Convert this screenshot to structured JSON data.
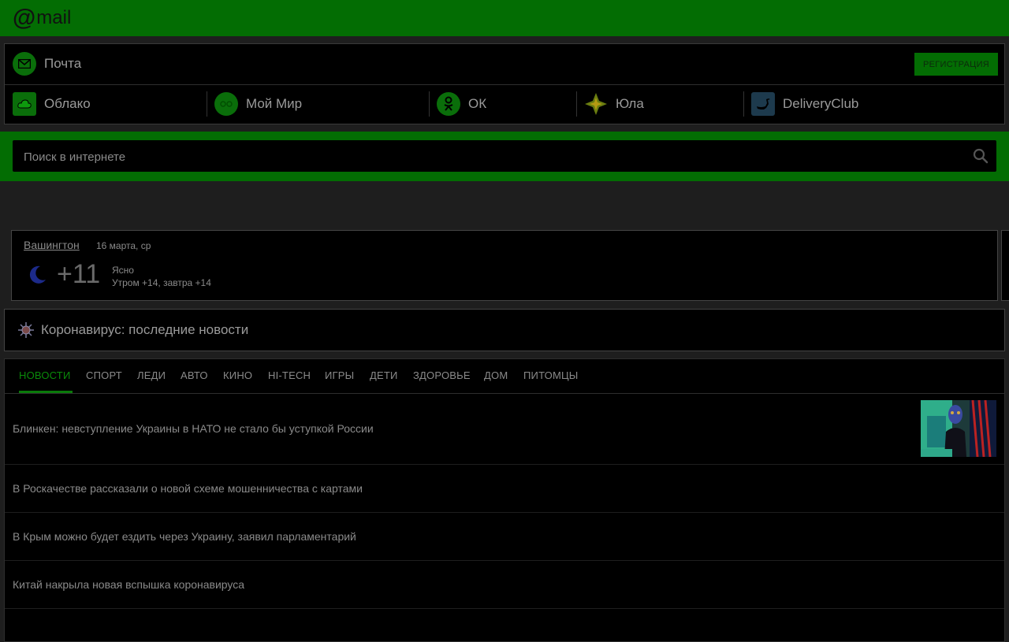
{
  "header": {
    "logo_at": "@",
    "logo_text": "mail"
  },
  "services": {
    "mail_label": "Почта",
    "register_label": "РЕГИСТРАЦИЯ",
    "items": [
      {
        "label": "Облако",
        "icon": "cloud-icon"
      },
      {
        "label": "Мой Мир",
        "icon": "my-world-icon"
      },
      {
        "label": "ОК",
        "icon": "ok-icon"
      },
      {
        "label": "Юла",
        "icon": "youla-icon"
      },
      {
        "label": "DeliveryClub",
        "icon": "delivery-club-icon"
      }
    ]
  },
  "search": {
    "placeholder": "Поиск в интернете"
  },
  "weather": {
    "city": "Вашингтон",
    "date": "16 марта, ср",
    "temperature": "+11",
    "condition": "Ясно",
    "forecast": "Утром +14, завтра +14"
  },
  "covid": {
    "label": "Коронавирус: последние новости"
  },
  "news": {
    "tabs": [
      {
        "label": "НОВОСТИ",
        "active": true
      },
      {
        "label": "СПОРТ"
      },
      {
        "label": "ЛЕДИ"
      },
      {
        "label": "АВТО"
      },
      {
        "label": "КИНО"
      },
      {
        "label": "HI-TECH"
      },
      {
        "label": "ИГРЫ"
      },
      {
        "label": "ДЕТИ"
      },
      {
        "label": "ЗДОРОВЬЕ"
      },
      {
        "label": "ДОМ"
      },
      {
        "label": "ПИТОМЦЫ"
      }
    ],
    "items": [
      {
        "title": "Блинкен: невступление Украины в НАТО не стало бы уступкой России"
      },
      {
        "title": "В Роскачестве рассказали о новой схеме мошенничества с картами"
      },
      {
        "title": "В Крым можно будет ездить через Украину, заявил парламентарий"
      },
      {
        "title": "Китай накрыла новая вспышка коронавируса"
      }
    ]
  },
  "colors": {
    "brand_green": "#036d03",
    "background": "#1e1e1e",
    "panel": "#000000"
  }
}
